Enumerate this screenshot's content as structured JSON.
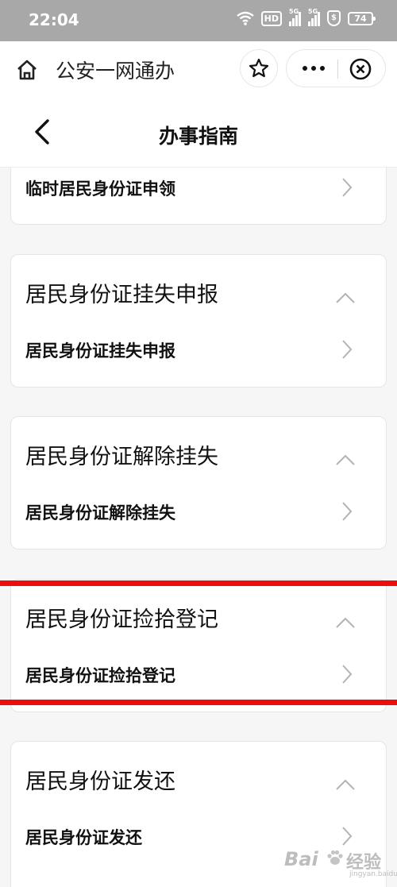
{
  "status_bar": {
    "time": "22:04",
    "hd_label": "HD",
    "net1": "5G",
    "net2": "5G",
    "shield_label": "$",
    "battery": "74"
  },
  "app_bar": {
    "title": "公安一网通办",
    "icons": [
      "home-icon",
      "star-icon",
      "more-icon",
      "close-icon"
    ]
  },
  "header": {
    "title": "办事指南"
  },
  "cards": [
    {
      "title": "",
      "item": "临时居民身份证申领"
    },
    {
      "title": "居民身份证挂失申报",
      "item": "居民身份证挂失申报"
    },
    {
      "title": "居民身份证解除挂失",
      "item": "居民身份证解除挂失"
    },
    {
      "title": "居民身份证捡拾登记",
      "item": "居民身份证捡拾登记"
    },
    {
      "title": "居民身份证发还",
      "item": "居民身份证发还"
    }
  ],
  "watermark": {
    "brand": "Bai",
    "brand2": "经验",
    "sub": "jingyan.baidu.com"
  },
  "colors": {
    "status_bar": "#a8a8a8",
    "highlight": "#ee0d0d",
    "watermark": "#bdbdbd"
  }
}
